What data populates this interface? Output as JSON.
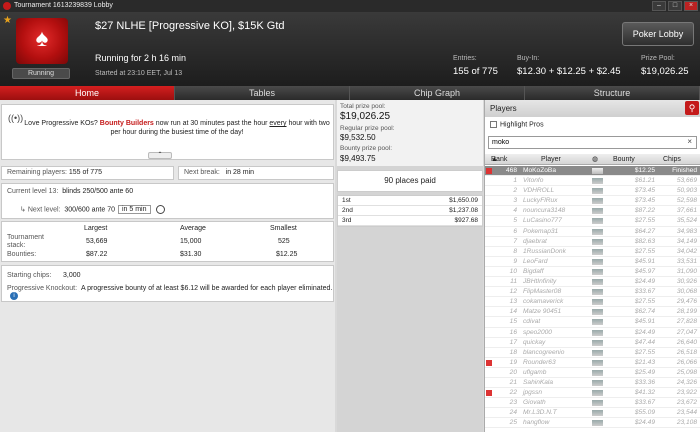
{
  "window": {
    "title": "Tournament 1613239839 Lobby"
  },
  "header": {
    "tournament_name": "$27 NLHE [Progressive KO], $15K Gtd",
    "status_badge": "Running",
    "running_for": "Running for 2 h 16 min",
    "started": "Started at 23:10 EET, Jul 13",
    "entrants_label": "Entries:",
    "entrants_value": "155 of 775",
    "buyin_label": "Buy-In:",
    "buyin_value": "$12.30 + $12.25 + $2.45",
    "prizepool_label": "Prize Pool:",
    "prizepool_value": "$19,026.25",
    "lobby_button": "Poker Lobby"
  },
  "tabs": [
    "Home",
    "Tables",
    "Chip Graph",
    "Structure"
  ],
  "promo": {
    "pre": "Love Progressive KOs? ",
    "highlight": "Bounty Builders",
    "mid": " now run at 30 minutes past the hour ",
    "underline": "every",
    "post": " hour with two per hour during the busiest time of the day!"
  },
  "home": {
    "remaining_label": "Remaining players:",
    "remaining_value": "155 of 775",
    "nextbreak_label": "Next break:",
    "nextbreak_value": "in 28 min",
    "current_level_label": "Current level 13:",
    "current_level_value": "blinds 250/500 ante 60",
    "next_level_label": "Next level:",
    "next_level_value": "300/600 ante 70",
    "next_level_in": "in 5 min",
    "stack_headers": [
      "Largest",
      "Average",
      "Smallest"
    ],
    "stack_label": "Tournament stack:",
    "stack_values": [
      "53,669",
      "15,000",
      "525"
    ],
    "bounty_label": "Bounties:",
    "bounty_values": [
      "$87.22",
      "$31.30",
      "$12.25"
    ],
    "starting_chips_label": "Starting chips:",
    "starting_chips_value": "3,000",
    "pko_label": "Progressive Knockout:",
    "pko_value": "A progressive bounty of at least $6.12 will be awarded for each player eliminated."
  },
  "prizes": {
    "total_label": "Total prize pool:",
    "total_value": "$19,026.25",
    "regular_label": "Regular prize pool:",
    "regular_value": "$9,532.50",
    "bounty_label": "Bounty prize pool:",
    "bounty_value": "$9,493.75",
    "places_paid": "90 places paid",
    "payouts": [
      {
        "place": "1st",
        "amount": "$1,650.09"
      },
      {
        "place": "2nd",
        "amount": "$1,237.08"
      },
      {
        "place": "3rd",
        "amount": "$927.68"
      }
    ]
  },
  "players": {
    "title": "Players",
    "highlight_pros": "Highlight Pros",
    "search_value": "moko",
    "clear": "×",
    "columns": [
      "Rank",
      "Player",
      "Bounty",
      "Chips"
    ],
    "rows": [
      {
        "rank": "468",
        "name": "MoKoZoBa",
        "bounty": "$12.25",
        "chips": "Finished",
        "sel": true,
        "mark": true
      },
      {
        "rank": "1",
        "name": "Vitonfo",
        "bounty": "$61.21",
        "chips": "53,669"
      },
      {
        "rank": "2",
        "name": "VDHROLL",
        "bounty": "$73.45",
        "chips": "50,903"
      },
      {
        "rank": "3",
        "name": "LuckyFlRux",
        "bounty": "$73.45",
        "chips": "52,598"
      },
      {
        "rank": "4",
        "name": "nouncura3148",
        "bounty": "$87.22",
        "chips": "37,661"
      },
      {
        "rank": "5",
        "name": "LuCasino777",
        "bounty": "$27.55",
        "chips": "35,524"
      },
      {
        "rank": "6",
        "name": "Pokemap31",
        "bounty": "$64.27",
        "chips": "34,983"
      },
      {
        "rank": "7",
        "name": "djaebrat",
        "bounty": "$82.63",
        "chips": "34,149"
      },
      {
        "rank": "8",
        "name": "1RussianDonk",
        "bounty": "$27.55",
        "chips": "34,042"
      },
      {
        "rank": "9",
        "name": "LeoFard",
        "bounty": "$45.91",
        "chips": "33,531"
      },
      {
        "rank": "10",
        "name": "Bigdaff",
        "bounty": "$45.97",
        "chips": "31,090"
      },
      {
        "rank": "11",
        "name": "JBHtInfinity",
        "bounty": "$24.49",
        "chips": "30,926"
      },
      {
        "rank": "12",
        "name": "FlipMaster08",
        "bounty": "$33.67",
        "chips": "30,068"
      },
      {
        "rank": "13",
        "name": "cokamaverick",
        "bounty": "$27.55",
        "chips": "29,476"
      },
      {
        "rank": "14",
        "name": "Matze 90451",
        "bounty": "$62.74",
        "chips": "28,199"
      },
      {
        "rank": "15",
        "name": "cdivat",
        "bounty": "$45.91",
        "chips": "27,828"
      },
      {
        "rank": "16",
        "name": "speo2000",
        "bounty": "$24.49",
        "chips": "27,047"
      },
      {
        "rank": "17",
        "name": "quickay",
        "bounty": "$47.44",
        "chips": "26,640"
      },
      {
        "rank": "18",
        "name": "blancogreenio",
        "bounty": "$27.55",
        "chips": "26,518"
      },
      {
        "rank": "19",
        "name": "Rounder63",
        "bounty": "$21.43",
        "chips": "26,066",
        "mark": true
      },
      {
        "rank": "20",
        "name": "uflgamb",
        "bounty": "$25.49",
        "chips": "25,098"
      },
      {
        "rank": "21",
        "name": "SahinKala",
        "bounty": "$33.36",
        "chips": "24,326"
      },
      {
        "rank": "22",
        "name": "jpgssn",
        "bounty": "$41.32",
        "chips": "23,922",
        "mark": true
      },
      {
        "rank": "23",
        "name": "Giovath",
        "bounty": "$33.67",
        "chips": "23,672"
      },
      {
        "rank": "24",
        "name": "Mr.L3D.N.T",
        "bounty": "$55.09",
        "chips": "23,544"
      },
      {
        "rank": "25",
        "name": "hangflow",
        "bounty": "$24.49",
        "chips": "23,108"
      }
    ]
  }
}
